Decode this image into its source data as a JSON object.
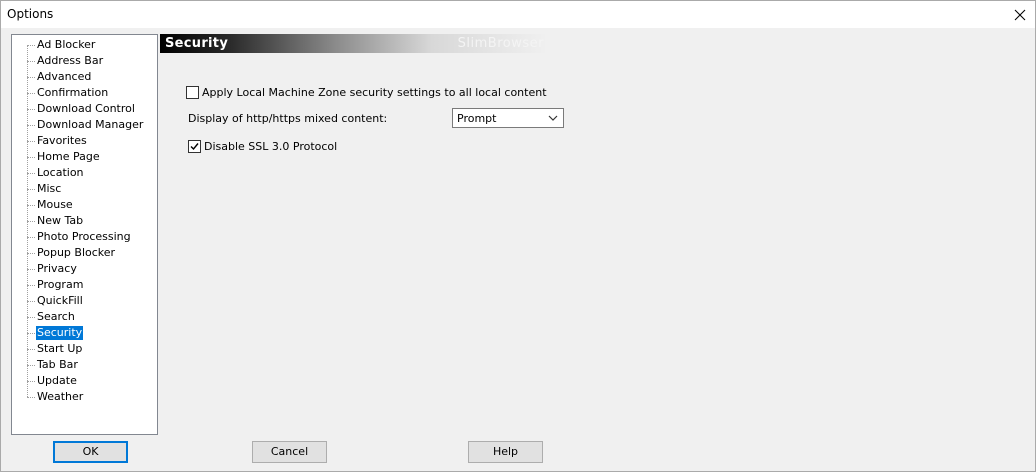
{
  "window": {
    "title": "Options"
  },
  "tree": {
    "items": [
      "Ad Blocker",
      "Address Bar",
      "Advanced",
      "Confirmation",
      "Download Control",
      "Download Manager",
      "Favorites",
      "Home Page",
      "Location",
      "Misc",
      "Mouse",
      "New Tab",
      "Photo Processing",
      "Popup Blocker",
      "Privacy",
      "Program",
      "QuickFill",
      "Search",
      "Security",
      "Start Up",
      "Tab Bar",
      "Update",
      "Weather"
    ],
    "selected": "Security"
  },
  "header": {
    "title": "Security",
    "brand": "SlimBrowser"
  },
  "settings": {
    "local_zone": {
      "label": "Apply Local Machine Zone security settings to all local content",
      "checked": false
    },
    "mixed_content": {
      "label": "Display of http/https mixed content:",
      "value": "Prompt"
    },
    "disable_ssl3": {
      "label": "Disable SSL 3.0 Protocol",
      "checked": true
    }
  },
  "buttons": {
    "ok": "OK",
    "cancel": "Cancel",
    "help": "Help"
  },
  "icons": {
    "close": "close-icon",
    "dropdown": "chevron-down-icon",
    "check": "check-icon"
  },
  "colors": {
    "selection": "#0078d7",
    "window_bg": "#f0f0f0"
  }
}
